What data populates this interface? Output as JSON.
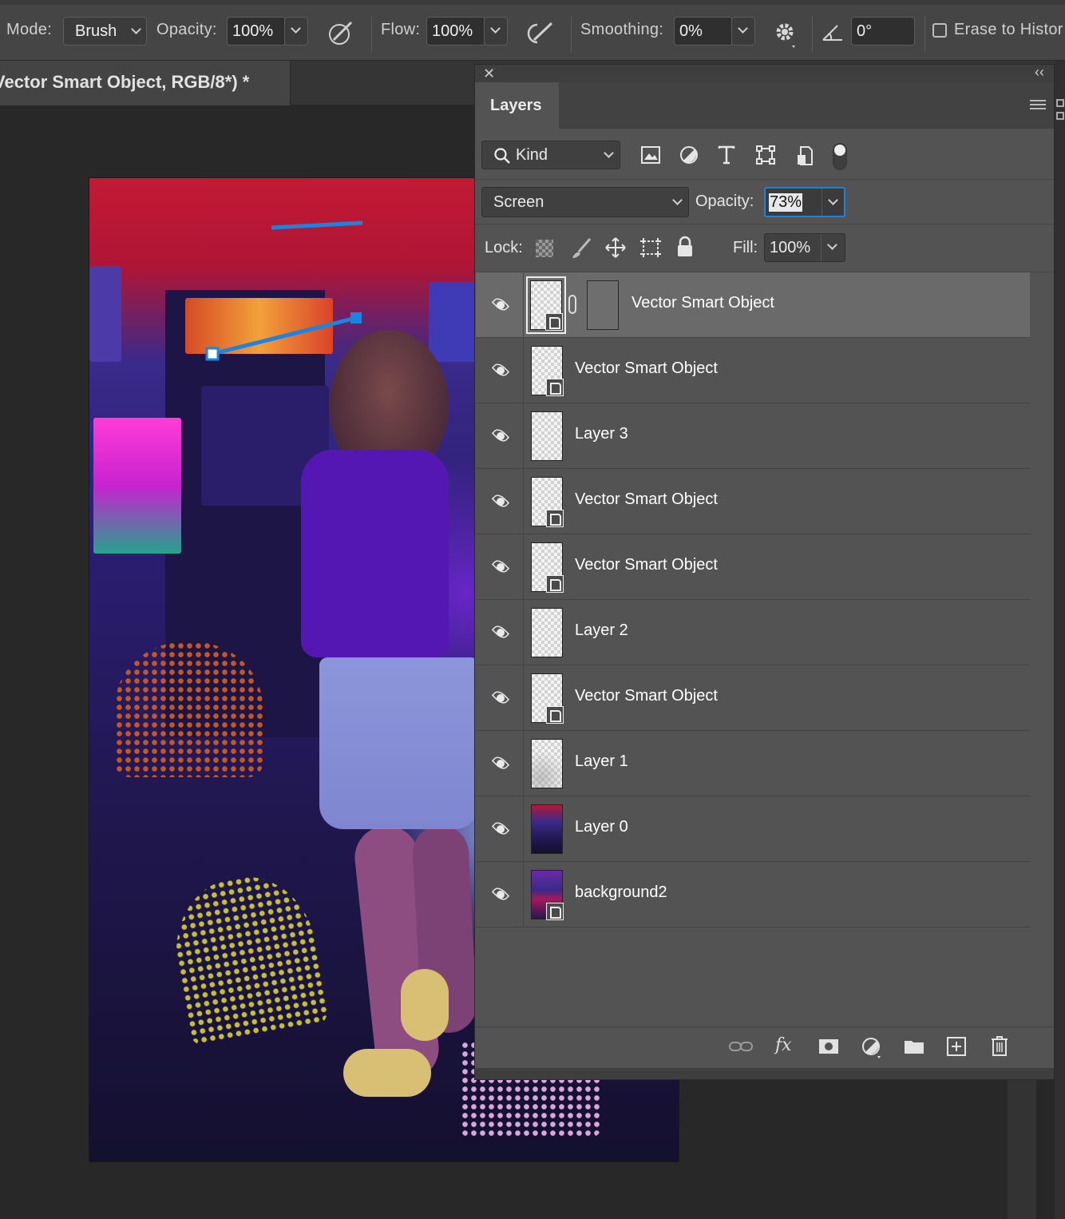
{
  "options_bar": {
    "mode_label": "Mode:",
    "mode_value": "Brush",
    "opacity_label": "Opacity:",
    "opacity_value": "100%",
    "flow_label": "Flow:",
    "flow_value": "100%",
    "smoothing_label": "Smoothing:",
    "smoothing_value": "0%",
    "angle_value": "0°",
    "erase_history_label": "Erase to Histor"
  },
  "document": {
    "tab_title": "Vector Smart Object, RGB/8*) *"
  },
  "layers_panel": {
    "tab_label": "Layers",
    "filter_kind": "Kind",
    "blend_mode": "Screen",
    "opacity_label": "Opacity:",
    "opacity_value": "73%",
    "lock_label": "Lock:",
    "fill_label": "Fill:",
    "fill_value": "100%",
    "layers": [
      {
        "name": "Vector Smart Object",
        "type": "smart",
        "active": true
      },
      {
        "name": "Vector Smart Object",
        "type": "smart"
      },
      {
        "name": "Layer 3",
        "type": "pixel"
      },
      {
        "name": "Vector Smart Object",
        "type": "smart"
      },
      {
        "name": "Vector Smart Object",
        "type": "smart"
      },
      {
        "name": "Layer 2",
        "type": "pixel"
      },
      {
        "name": "Vector Smart Object",
        "type": "smart"
      },
      {
        "name": "Layer 1",
        "type": "pixel"
      },
      {
        "name": "Layer 0",
        "type": "photo"
      },
      {
        "name": "background2",
        "type": "photo-smart"
      }
    ],
    "bottom_fx_label": "fx"
  },
  "colors": {
    "panel_bg": "#535353",
    "active_row": "#6a6a6a",
    "accent_blue": "#1b84e0"
  }
}
